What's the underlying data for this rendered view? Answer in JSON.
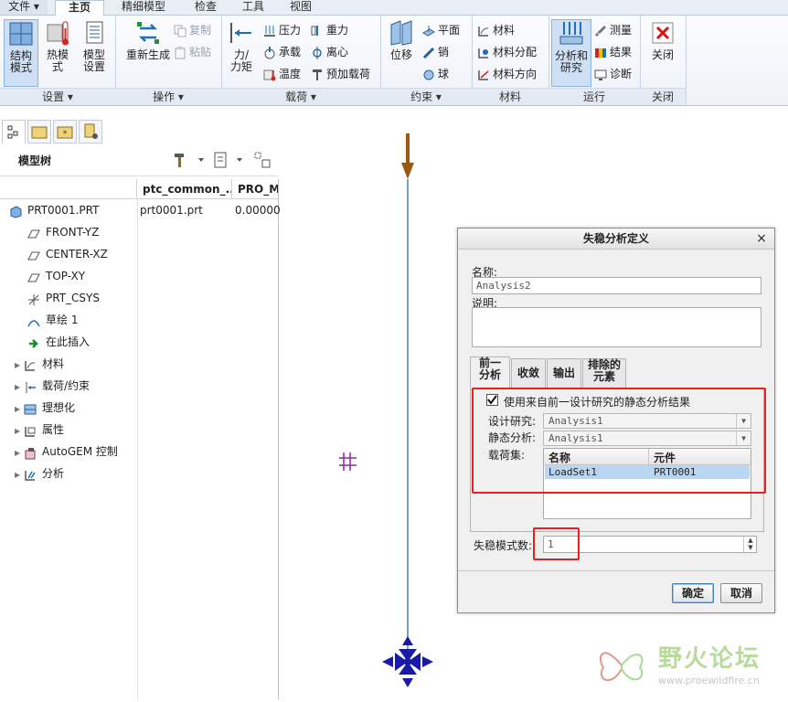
{
  "ribbon": {
    "tabs": [
      "文件 ▾",
      "主页",
      "精细模型",
      "检查",
      "工具",
      "视图"
    ],
    "groups": {
      "setup": {
        "label": "设置 ▾",
        "buttons": [
          "结构\n模式",
          "热模\n式",
          "模型\n设置"
        ]
      },
      "operation": {
        "label": "操作 ▾",
        "regenerate": "重新生成",
        "copy": "复制",
        "paste": "粘贴"
      },
      "loads": {
        "label": "载荷 ▾",
        "force": "力/\n力矩",
        "pressure": "压力",
        "gravity": "重力",
        "bearing": "承载",
        "centrifugal": "离心",
        "temperature": "温度",
        "preload": "预加载荷"
      },
      "constraints": {
        "label": "约束 ▾",
        "displacement": "位移",
        "plane": "平面",
        "pin": "销",
        "ball": "球"
      },
      "material": {
        "label": "材料",
        "material": "材料",
        "assign": "材料分配",
        "direction": "材料方向"
      },
      "run": {
        "label": "运行",
        "analysis": "分析和\n研究",
        "measure": "测量",
        "results": "结果",
        "diagnose": "诊断"
      },
      "close": {
        "label": "关闭",
        "close": "关闭"
      }
    }
  },
  "model_tree": {
    "title": "模型树",
    "columns": [
      "ptc_common_...",
      "PRO_M"
    ],
    "items": [
      {
        "label": "PRT0001.PRT",
        "col1": "prt0001.prt",
        "col2": "0.00000",
        "icon": "part-icon"
      },
      {
        "label": "FRONT-YZ",
        "icon": "datum-plane-icon"
      },
      {
        "label": "CENTER-XZ",
        "icon": "datum-plane-icon"
      },
      {
        "label": "TOP-XY",
        "icon": "datum-plane-icon"
      },
      {
        "label": "PRT_CSYS",
        "icon": "csys-icon"
      },
      {
        "label": "草绘 1",
        "icon": "sketch-icon"
      },
      {
        "label": "在此插入",
        "icon": "insert-arrow-icon"
      },
      {
        "label": "材料",
        "icon": "material-icon"
      },
      {
        "label": "载荷/约束",
        "icon": "loads-icon"
      },
      {
        "label": "理想化",
        "icon": "idealization-icon"
      },
      {
        "label": "属性",
        "icon": "properties-icon"
      },
      {
        "label": "AutoGEM 控制",
        "icon": "autogem-icon"
      },
      {
        "label": "分析",
        "icon": "analysis-icon"
      }
    ]
  },
  "dialog": {
    "title": "失稳分析定义",
    "close_glyph": "×",
    "name_label": "名称:",
    "name_value": "Analysis2",
    "desc_label": "说明:",
    "tabs": [
      "前一\n分析",
      "收敛",
      "输出",
      "排除的\n元素"
    ],
    "use_prev_label": "使用来自前一设计研究的静态分析结果",
    "use_prev_checked": true,
    "design_study_label": "设计研究:",
    "design_study_value": "Analysis1",
    "static_label": "静态分析:",
    "static_value": "Analysis1",
    "loadset_label": "载荷集:",
    "loadset_headers": [
      "名称",
      "元件"
    ],
    "loadset_rows": [
      {
        "name": "LoadSet1",
        "component": "PRT0001"
      }
    ],
    "modes_label": "失稳模式数:",
    "modes_value": "1",
    "ok": "确定",
    "cancel": "取消"
  },
  "watermark": {
    "brand": "野火论坛",
    "url": "www.proewildfire.cn"
  },
  "colors": {
    "accent": "#3b7fd1",
    "highlight_red": "#e81f1f",
    "beam": "#4a7fb5",
    "load_arrow": "#9a5a12",
    "constraint": "#1a1aa8",
    "mesh_mark": "#8a2a9a"
  }
}
